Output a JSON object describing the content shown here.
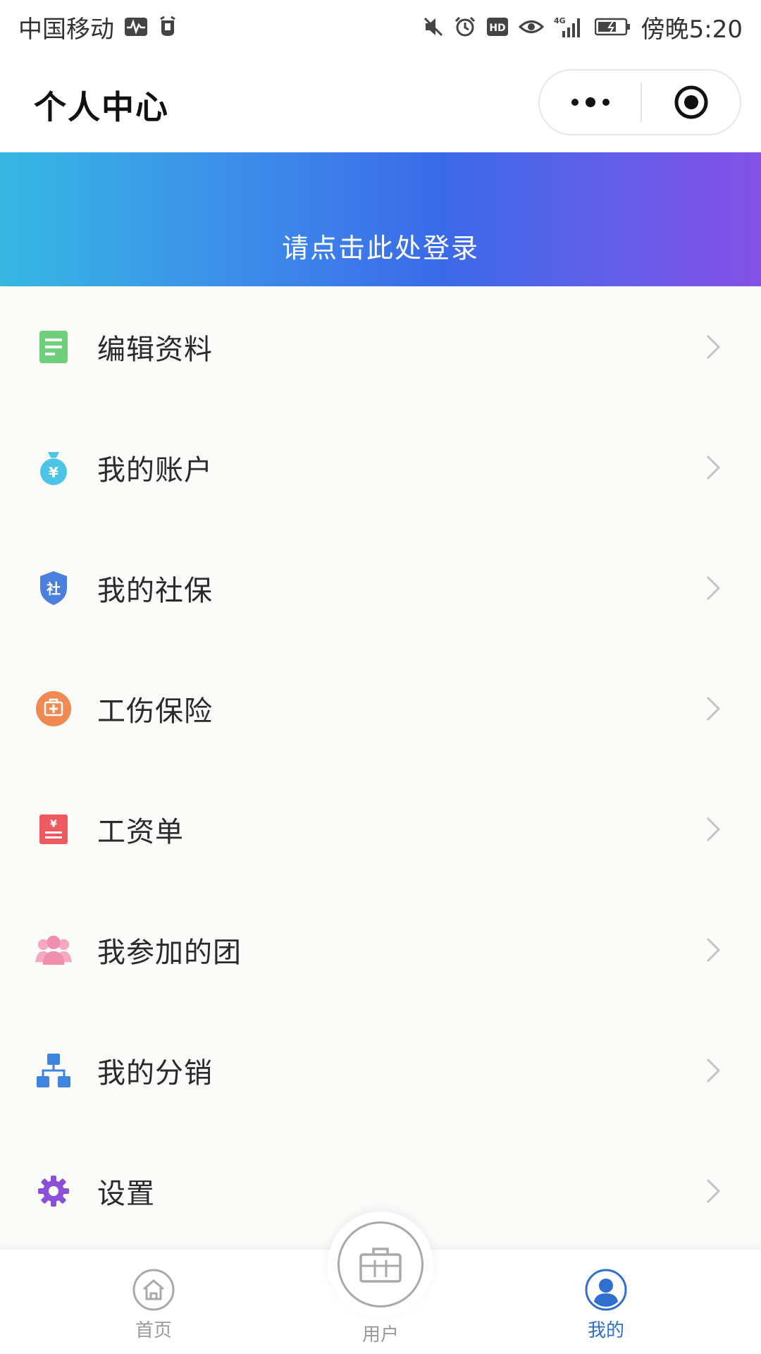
{
  "status_bar": {
    "carrier": "中国移动",
    "network": "4G",
    "time": "傍晚5:20",
    "icons": [
      "activity-icon",
      "alarm-tag-icon",
      "mute-icon",
      "alarm-icon",
      "hd-icon",
      "eye-icon",
      "signal-icon",
      "battery-icon"
    ]
  },
  "header": {
    "title": "个人中心",
    "capsule": {
      "more_icon": "more-dots-icon",
      "close_icon": "target-close-icon"
    }
  },
  "banner": {
    "login_text": "请点击此处登录",
    "gradient": [
      "#35b8e2",
      "#3a6ae9",
      "#8551e6"
    ]
  },
  "menu": {
    "items": [
      {
        "label": "编辑资料",
        "icon": "document-icon",
        "color": "#6fd07a"
      },
      {
        "label": "我的账户",
        "icon": "money-bag-icon",
        "color": "#4cc4e8"
      },
      {
        "label": "我的社保",
        "icon": "social-security-shield-icon",
        "color": "#4a7fe0"
      },
      {
        "label": "工伤保险",
        "icon": "medical-kit-icon",
        "color": "#f08a52"
      },
      {
        "label": "工资单",
        "icon": "payslip-icon",
        "color": "#ef5960"
      },
      {
        "label": "我参加的团",
        "icon": "group-icon",
        "color": "#f18fae"
      },
      {
        "label": "我的分销",
        "icon": "hierarchy-icon",
        "color": "#3f84df"
      },
      {
        "label": "设置",
        "icon": "gear-icon",
        "color": "#8b4fd8"
      }
    ]
  },
  "tabbar": {
    "tabs": [
      {
        "label": "首页",
        "icon": "home-icon"
      },
      {
        "label": "用户",
        "icon": "briefcase-icon"
      },
      {
        "label": "我的",
        "icon": "user-icon",
        "active": true
      }
    ],
    "active_color": "#2f6fd0",
    "inactive_color": "#9a9a9a"
  }
}
